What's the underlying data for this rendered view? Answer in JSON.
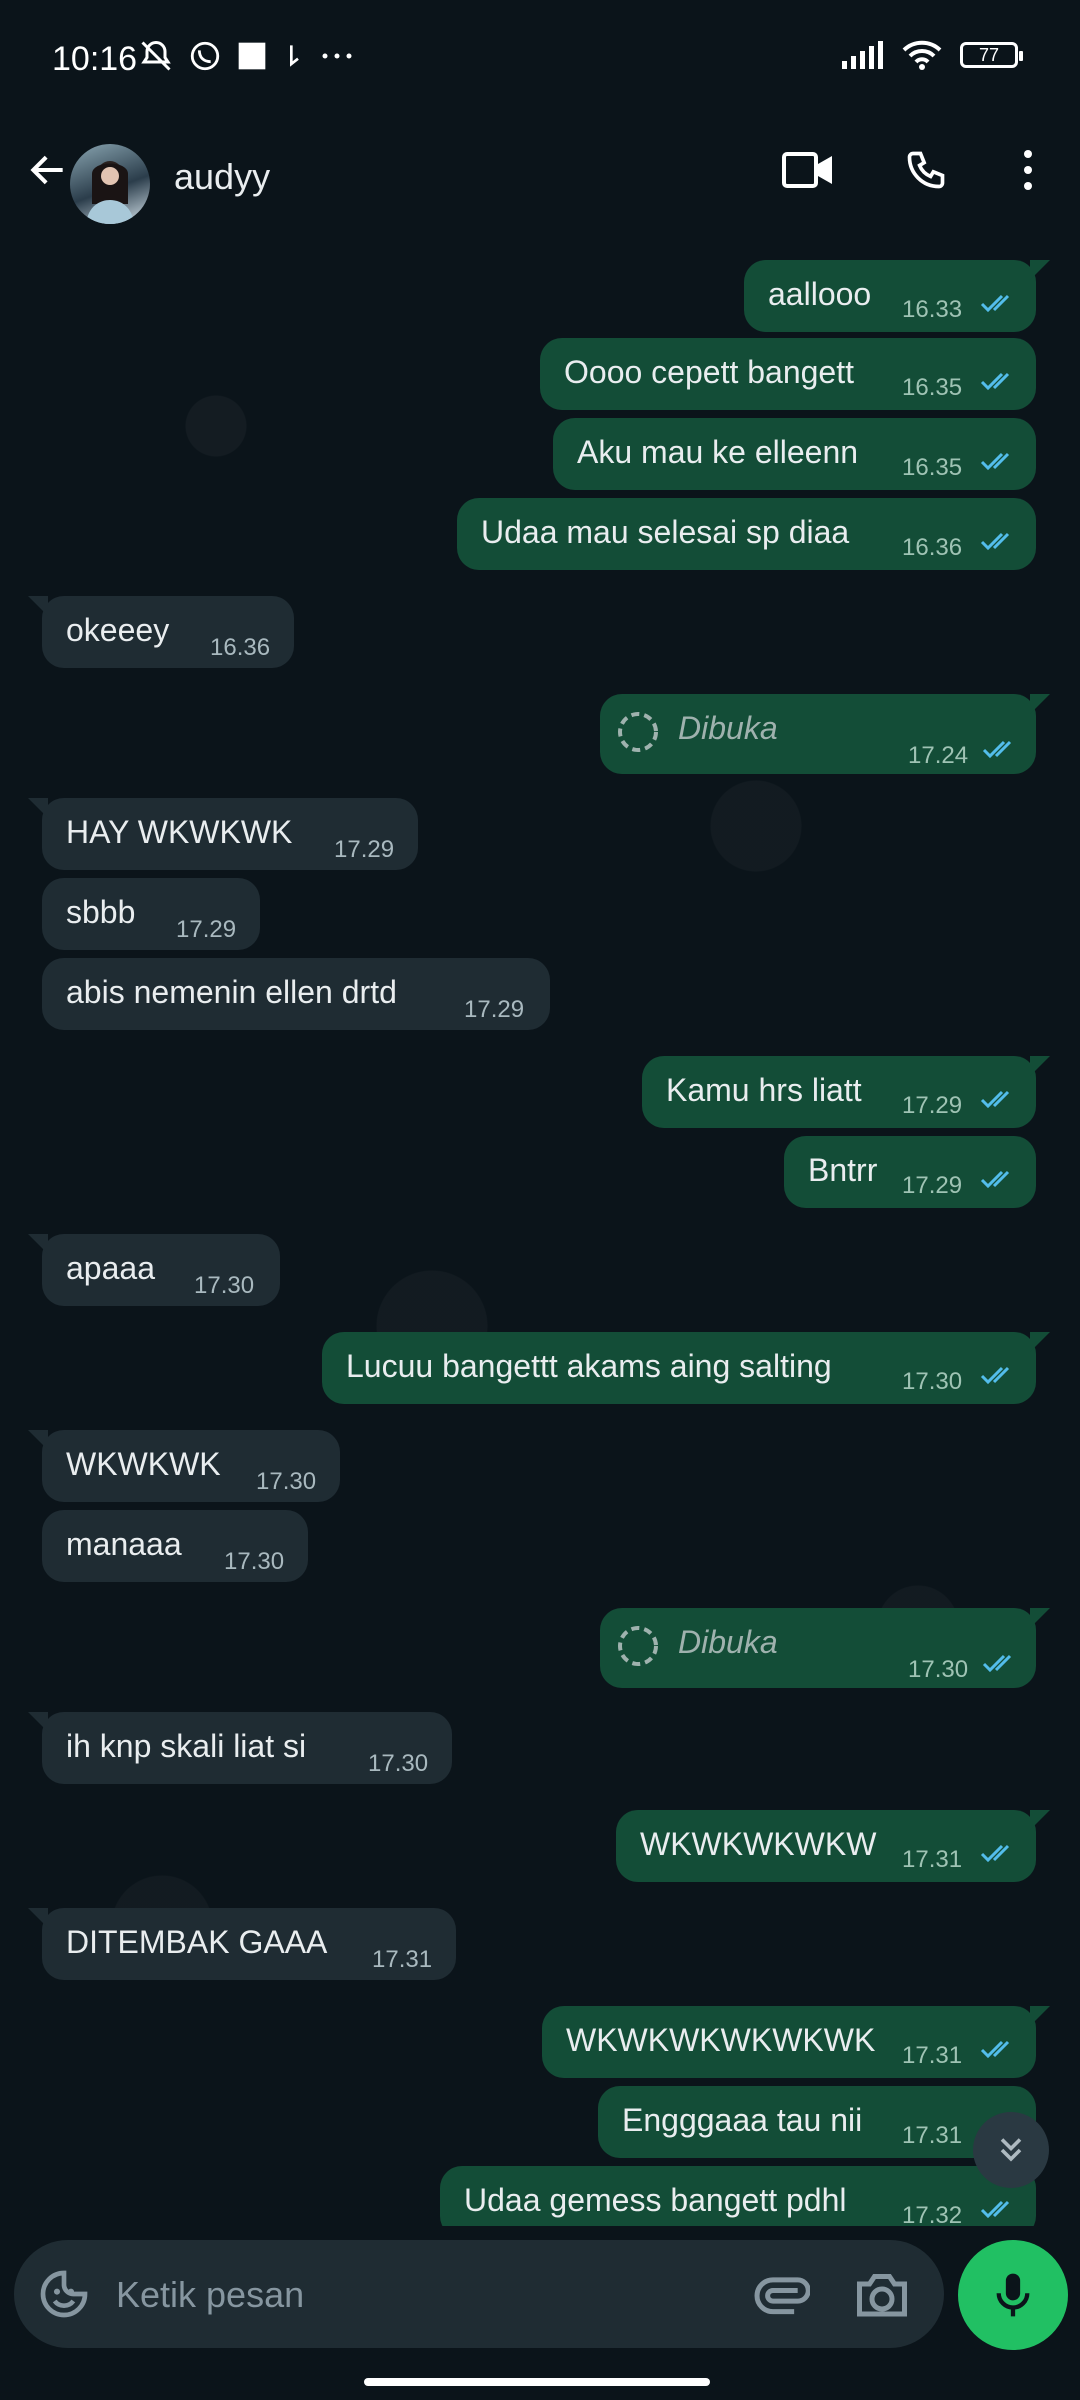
{
  "status_bar": {
    "time": "10:16",
    "battery": "77"
  },
  "header": {
    "contact_name": "audyy"
  },
  "messages": [
    {
      "dir": "out",
      "text": "aallooo",
      "time": "16.33"
    },
    {
      "dir": "out",
      "text": "Oooo cepett bangett",
      "time": "16.35"
    },
    {
      "dir": "out",
      "text": "Aku mau ke elleenn",
      "time": "16.35"
    },
    {
      "dir": "out",
      "text": "Udaa mau selesai sp diaa",
      "time": "16.36"
    },
    {
      "dir": "in",
      "text": "okeeey",
      "time": "16.36"
    },
    {
      "dir": "out",
      "text": "Dibuka",
      "time": "17.24",
      "view_once": true
    },
    {
      "dir": "in",
      "text": "HAY WKWKWK",
      "time": "17.29"
    },
    {
      "dir": "in",
      "text": "sbbb",
      "time": "17.29"
    },
    {
      "dir": "in",
      "text": "abis nemenin ellen drtd",
      "time": "17.29"
    },
    {
      "dir": "out",
      "text": "Kamu hrs liatt",
      "time": "17.29"
    },
    {
      "dir": "out",
      "text": "Bntrr",
      "time": "17.29"
    },
    {
      "dir": "in",
      "text": "apaaa",
      "time": "17.30"
    },
    {
      "dir": "out",
      "text": "Lucuu bangettt akams aing salting",
      "time": "17.30"
    },
    {
      "dir": "in",
      "text": "WKWKWK",
      "time": "17.30"
    },
    {
      "dir": "in",
      "text": "manaaa",
      "time": "17.30"
    },
    {
      "dir": "out",
      "text": "Dibuka",
      "time": "17.30",
      "view_once": true
    },
    {
      "dir": "in",
      "text": "ih knp skali liat si",
      "time": "17.30"
    },
    {
      "dir": "out",
      "text": "WKWKWKWKW",
      "time": "17.31"
    },
    {
      "dir": "in",
      "text": "DITEMBAK GAAA",
      "time": "17.31"
    },
    {
      "dir": "out",
      "text": "WKWKWKWKWKWK",
      "time": "17.31"
    },
    {
      "dir": "out",
      "text": "Engggaaa tau nii",
      "time": "17.31"
    },
    {
      "dir": "out",
      "text": "Udaa gemess bangett pdhl",
      "time": "17.32"
    }
  ],
  "input": {
    "placeholder": "Ketik pesan"
  },
  "colors": {
    "outgoing_bubble": "#134d37",
    "incoming_bubble": "#1f2c33",
    "read_ticks": "#53bdeb",
    "mic_button": "#21c063"
  }
}
